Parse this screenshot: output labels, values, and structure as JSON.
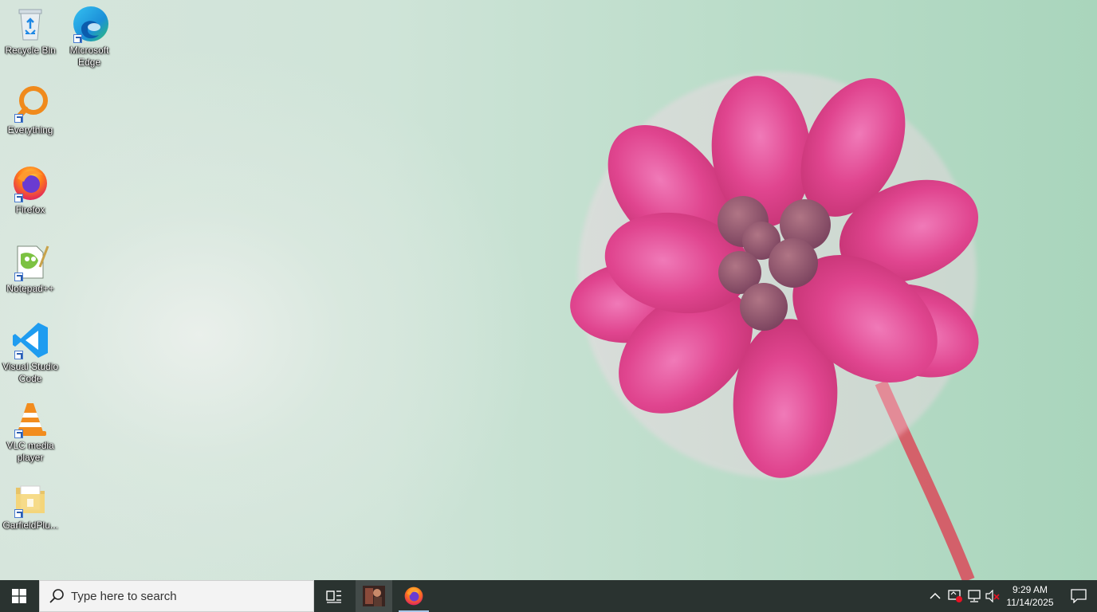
{
  "desktop": {
    "icons": [
      {
        "label": "Recycle Bin",
        "icon": "recycle-bin-icon"
      },
      {
        "label": "Microsoft Edge",
        "icon": "edge-icon"
      },
      {
        "label": "Everything",
        "icon": "everything-icon"
      },
      {
        "label": "Firefox",
        "icon": "firefox-icon"
      },
      {
        "label": "Notepad++",
        "icon": "notepad-plus-plus-icon"
      },
      {
        "label": "Visual Studio Code",
        "icon": "vscode-icon"
      },
      {
        "label": "VLC media player",
        "icon": "vlc-icon"
      },
      {
        "label": "GarfieldPlu...",
        "icon": "folder-icon"
      }
    ]
  },
  "taskbar": {
    "search_placeholder": "Type here to search",
    "clock": {
      "time": "9:29 AM",
      "date": "11/14/2025"
    },
    "colors": {
      "background": "#2a3330",
      "accent": "#a9c7e8"
    }
  }
}
